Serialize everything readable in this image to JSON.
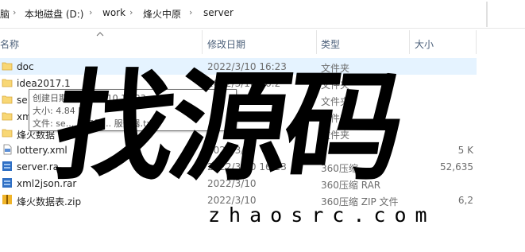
{
  "breadcrumb": {
    "items": [
      "脑",
      "本地磁盘 (D:)",
      "work",
      "烽火中原",
      "server"
    ],
    "separator": "›"
  },
  "columns": {
    "name": "名称",
    "modified": "修改日期",
    "type": "类型",
    "size": "大小"
  },
  "files": [
    {
      "name": "doc",
      "date": "2022/3/10 16:23",
      "type": "文件夹",
      "size": "",
      "icon": "folder-icon",
      "selected": true
    },
    {
      "name": "idea2017.1",
      "date": "2022/3/10 16:2",
      "type": "文件夹",
      "size": "",
      "icon": "folder-icon",
      "selected": false
    },
    {
      "name": "se",
      "date": "",
      "type": "文件夹",
      "size": "",
      "icon": "folder-icon",
      "selected": false
    },
    {
      "name": "xm",
      "date": "",
      "type": "文件夹",
      "size": "",
      "icon": "folder-icon",
      "selected": false
    },
    {
      "name": "烽火数据",
      "date": "",
      "type": "文件夹",
      "size": "",
      "icon": "folder-icon",
      "selected": false
    },
    {
      "name": "lottery.xml",
      "date": "2022/3/",
      "type": "",
      "size": "5 K",
      "icon": "xml-file-icon",
      "selected": false
    },
    {
      "name": "server.ra",
      "date": "2022/3/10 16:23",
      "type": "360压缩",
      "size": "52,635",
      "icon": "rar-archive-icon",
      "selected": false
    },
    {
      "name": "xml2json.rar",
      "date": "2022/3/10",
      "type": "360压缩 RAR",
      "size": "",
      "icon": "rar-archive-icon",
      "selected": false
    },
    {
      "name": "烽火数据表.zip",
      "date": "2022/3/10",
      "type": "360压缩 ZIP 文件",
      "size": "6,2",
      "icon": "zip-archive-icon",
      "selected": false
    }
  ],
  "tooltip": {
    "created": "创建日期: 2022/3/10 16:23",
    "size": "大小: 4.84 M",
    "files": "文件: se... 服务器... 服务器.txt"
  },
  "watermark": {
    "text": "找源码",
    "url": "zhaosrc.com"
  },
  "colors": {
    "selection": "#e5f3ff",
    "folder": "#f8d775",
    "header_text": "#4c607a"
  }
}
